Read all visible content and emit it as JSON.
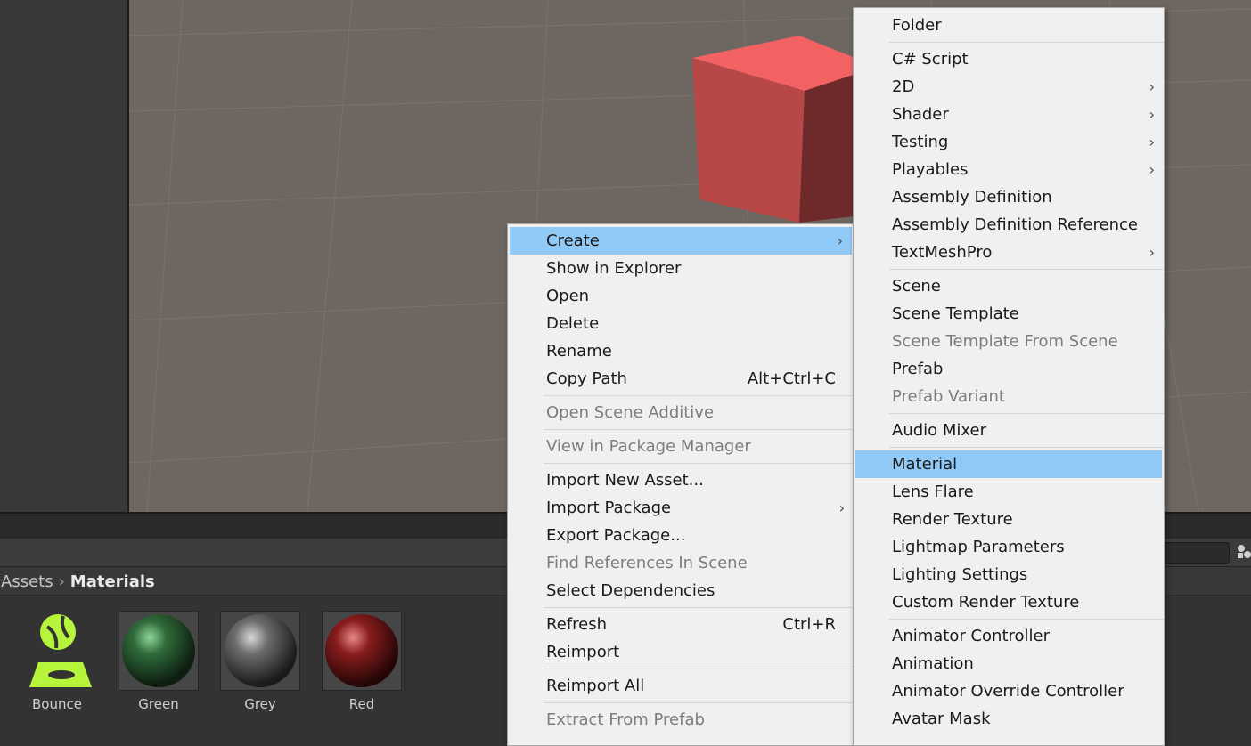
{
  "breadcrumb": {
    "root": "Assets",
    "current": "Materials"
  },
  "assets": [
    {
      "name": "Bounce",
      "icon": "physic-material-icon",
      "color": "#b6f53c"
    },
    {
      "name": "Green",
      "icon": "sphere-material-icon",
      "color": "#2f6b3a"
    },
    {
      "name": "Grey",
      "icon": "sphere-material-icon",
      "color": "#6d6d6d"
    },
    {
      "name": "Red",
      "icon": "sphere-material-icon",
      "color": "#8a1d1d"
    }
  ],
  "context_menu": {
    "items": [
      {
        "label": "Create",
        "arrow": "›"
      },
      {
        "label": "Show in Explorer"
      },
      {
        "label": "Open"
      },
      {
        "label": "Delete"
      },
      {
        "label": "Rename"
      },
      {
        "label": "Copy Path",
        "shortcut": "Alt+Ctrl+C"
      },
      {
        "label": "Open Scene Additive"
      },
      {
        "label": "View in Package Manager"
      },
      {
        "label": "Import New Asset..."
      },
      {
        "label": "Import Package",
        "arrow": "›"
      },
      {
        "label": "Export Package..."
      },
      {
        "label": "Find References In Scene"
      },
      {
        "label": "Select Dependencies"
      },
      {
        "label": "Refresh",
        "shortcut": "Ctrl+R"
      },
      {
        "label": "Reimport"
      },
      {
        "label": "Reimport All"
      },
      {
        "label": "Extract From Prefab"
      }
    ]
  },
  "create_menu": {
    "items": [
      {
        "label": "Folder"
      },
      {
        "label": "C# Script"
      },
      {
        "label": "2D",
        "arrow": "›"
      },
      {
        "label": "Shader",
        "arrow": "›"
      },
      {
        "label": "Testing",
        "arrow": "›"
      },
      {
        "label": "Playables",
        "arrow": "›"
      },
      {
        "label": "Assembly Definition"
      },
      {
        "label": "Assembly Definition Reference"
      },
      {
        "label": "TextMeshPro",
        "arrow": "›"
      },
      {
        "label": "Scene"
      },
      {
        "label": "Scene Template"
      },
      {
        "label": "Scene Template From Scene"
      },
      {
        "label": "Prefab"
      },
      {
        "label": "Prefab Variant"
      },
      {
        "label": "Audio Mixer"
      },
      {
        "label": "Material"
      },
      {
        "label": "Lens Flare"
      },
      {
        "label": "Render Texture"
      },
      {
        "label": "Lightmap Parameters"
      },
      {
        "label": "Lighting Settings"
      },
      {
        "label": "Custom Render Texture"
      },
      {
        "label": "Animator Controller"
      },
      {
        "label": "Animation"
      },
      {
        "label": "Animator Override Controller"
      },
      {
        "label": "Avatar Mask"
      }
    ]
  },
  "colors": {
    "highlight": "#91c9f7",
    "cube_front": "#b84747",
    "cube_top": "#f26262",
    "cube_side": "#6e2a2a",
    "scene_bg": "#6e6761"
  }
}
